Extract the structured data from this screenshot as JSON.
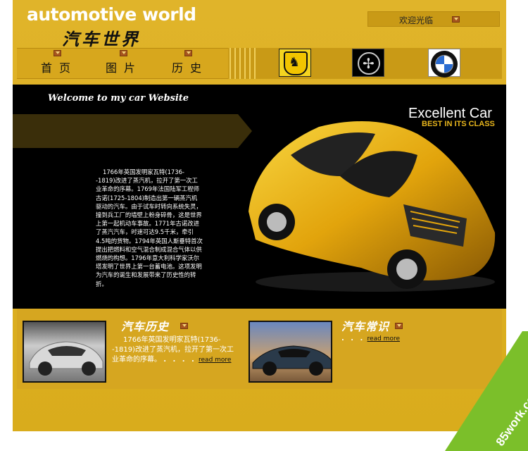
{
  "header": {
    "logo_text": "automotive world",
    "logo_cn": "汽车世界",
    "welcome_label": "欢迎光临"
  },
  "nav": {
    "items": [
      {
        "label": "首页"
      },
      {
        "label": "图片"
      },
      {
        "label": "历史"
      }
    ],
    "brands": [
      {
        "name": "Ferrari"
      },
      {
        "name": "Mercedes-Benz"
      },
      {
        "name": "BMW"
      }
    ]
  },
  "hero": {
    "tagline": "Welcome to my car Website",
    "headline": "Excellent Car",
    "subline": "BEST IN ITS CLASS",
    "story": "1766年英国发明家瓦特(1736--1819)改进了蒸汽机，拉开了第一次工业革命的序幕。1769年法国陆军工程师古诺(1725-1804)制造出第一辆蒸汽机驱动的汽车。由于试车时转向系统失灵，撞到兵工厂的墙壁上粉身碎骨，这是世界上第一起机动车事故。1771年古诺改进了蒸汽汽车，时速可达9.5千米，牵引4.5吨的货物。1794年英国人斯垂特首次提出把燃料和空气混合制成混合气体以供燃烧的构想。1796年意大利科学家沃尔塔发明了世界上第一台蓄电池。这项发明为汽车的诞生和发展带来了历史性的转折。"
  },
  "sections": [
    {
      "title": "汽车历史",
      "text": "1766年英国发明家瓦特(1736--1819)改进了蒸汽机，拉开了第一次工业革命的序幕。",
      "more": "read more",
      "dots": ". . . ."
    },
    {
      "title": "汽车常识",
      "text": "",
      "more": "read more",
      "dots": ". . ."
    }
  ],
  "watermark": "85work.com",
  "colors": {
    "page_bg": "#ddb020",
    "hero_bg": "#000000",
    "accent": "#e7b51c",
    "dropdown": "#a6541e"
  }
}
